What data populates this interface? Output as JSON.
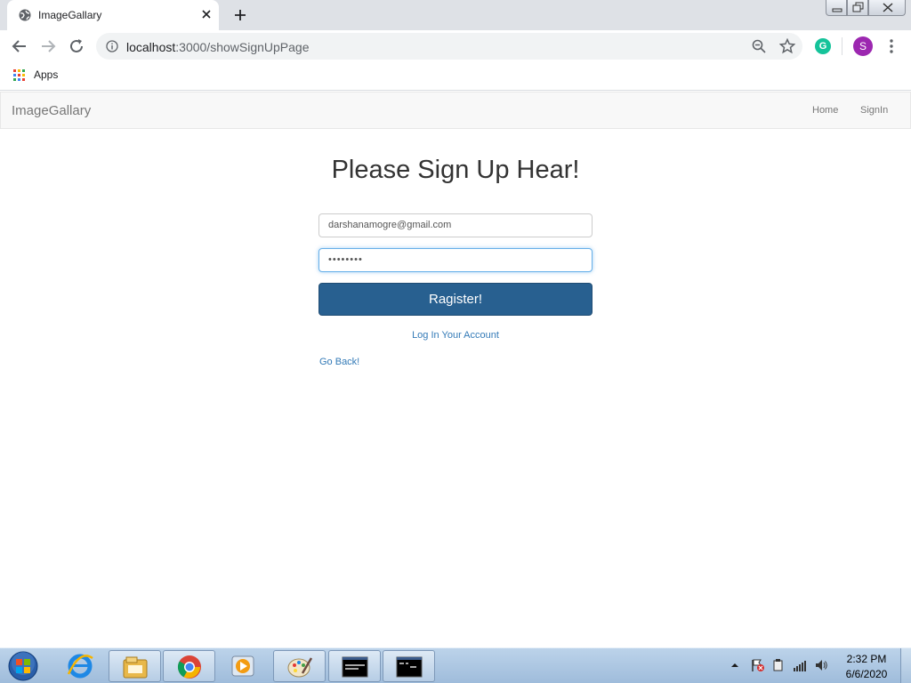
{
  "browser": {
    "tab_title": "ImageGallary",
    "url_host": "localhost",
    "url_path": ":3000/showSignUpPage",
    "profile_initial": "S",
    "extension_initial": "G",
    "bookmarks": {
      "apps_label": "Apps"
    }
  },
  "navbar": {
    "brand": "ImageGallary",
    "links": [
      "Home",
      "SignIn"
    ]
  },
  "form": {
    "heading": "Please Sign Up Hear!",
    "email_value": "darshanamogre@gmail.com",
    "password_value": "••••••••",
    "submit_label": "Ragister!",
    "login_link": "Log In Your Account",
    "back_link": "Go Back!"
  },
  "taskbar": {
    "time": "2:32 PM",
    "date": "6/6/2020"
  },
  "colors": {
    "primary_button": "#286090",
    "link": "#337ab7",
    "navbar_bg": "#f8f8f8"
  }
}
